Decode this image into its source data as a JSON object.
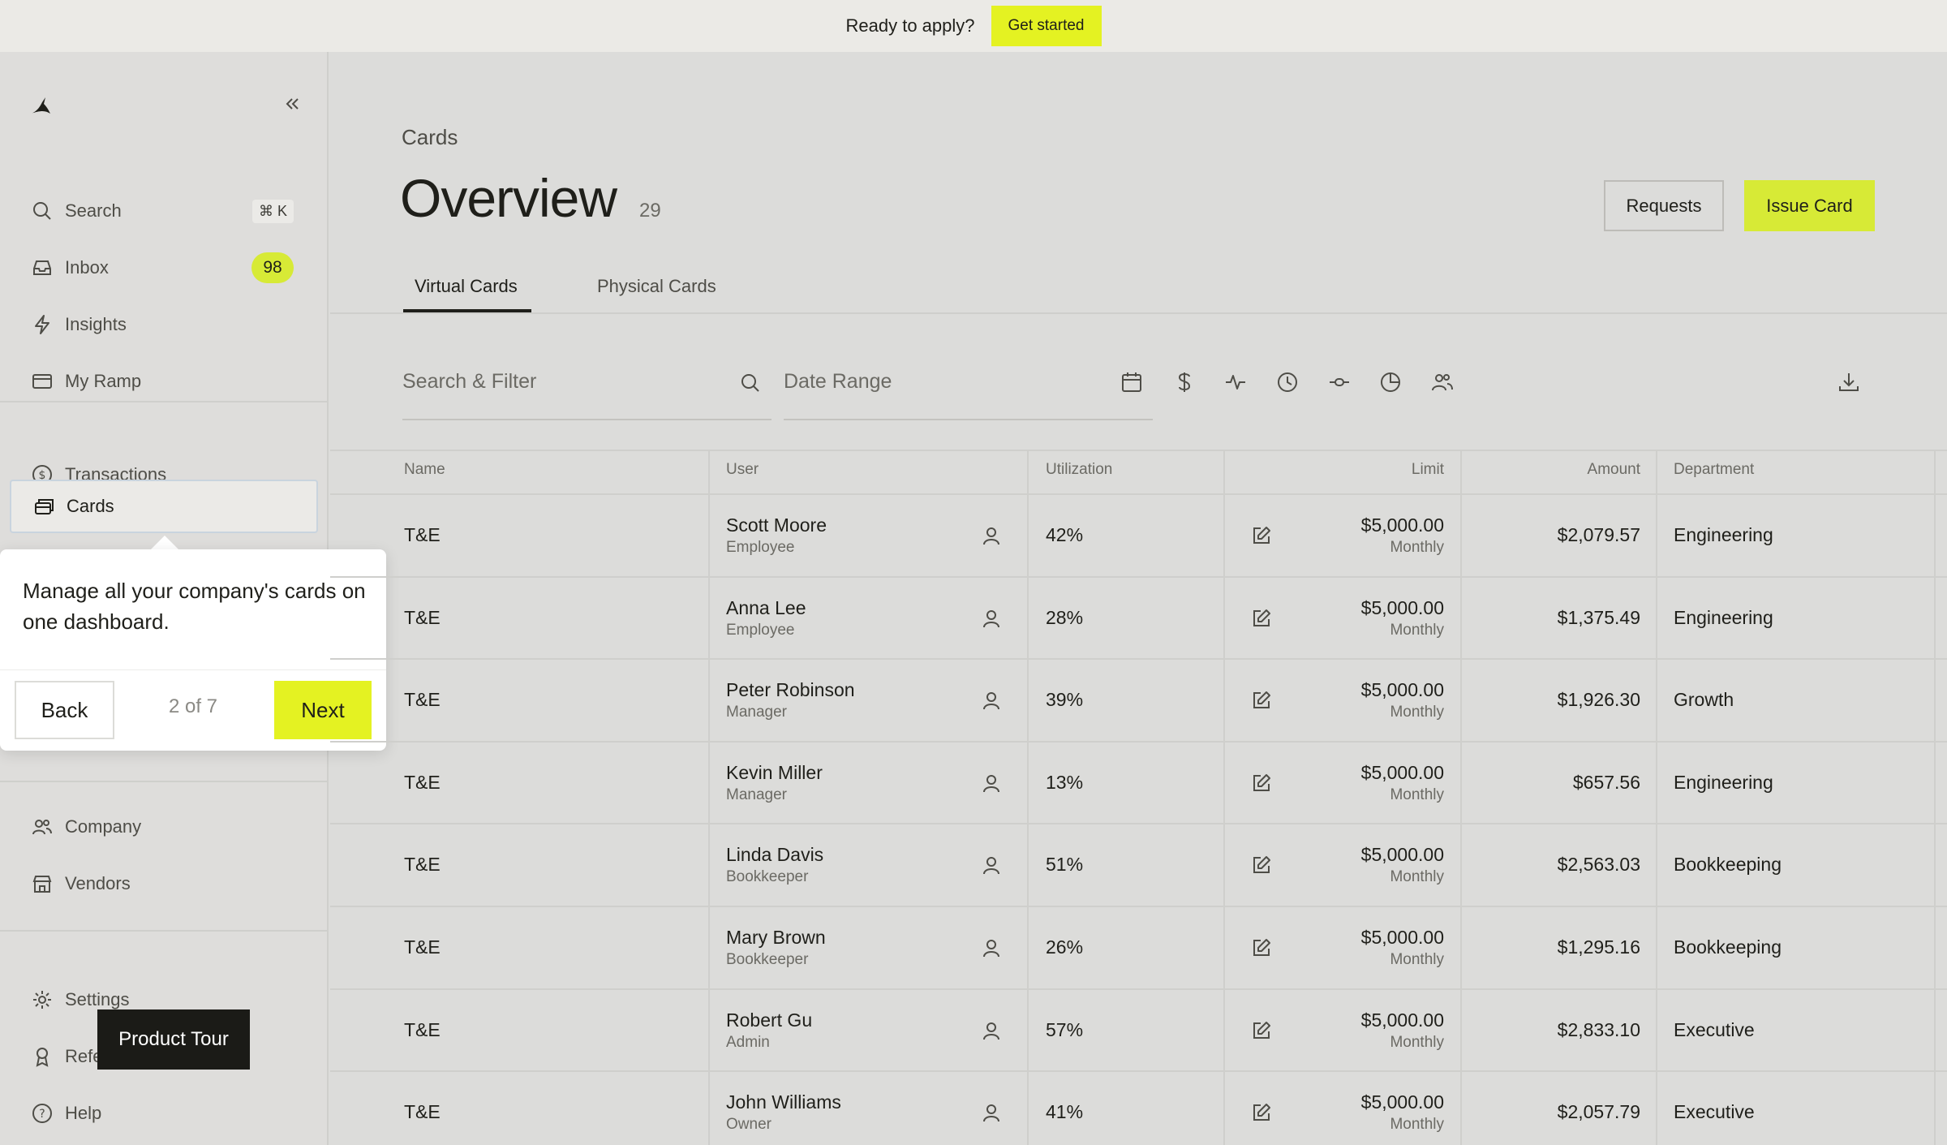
{
  "banner": {
    "text": "Ready to apply?",
    "cta": "Get started"
  },
  "sidebar": {
    "search": {
      "label": "Search",
      "shortcut": "⌘ K"
    },
    "inbox": {
      "label": "Inbox",
      "count": "98"
    },
    "insights": "Insights",
    "my_ramp": "My Ramp",
    "transactions": "Transactions",
    "cards": "Cards",
    "company": "Company",
    "vendors": "Vendors",
    "settings": "Settings",
    "referrals": "Refe",
    "help": "Help"
  },
  "tour": {
    "text": "Manage all your company's cards on one dashboard.",
    "back": "Back",
    "progress": "2 of 7",
    "next": "Next",
    "pill": "Product Tour"
  },
  "header": {
    "breadcrumb": "Cards",
    "title": "Overview",
    "count": "29",
    "requests": "Requests",
    "issue": "Issue Card"
  },
  "tabs": {
    "virtual": "Virtual Cards",
    "physical": "Physical Cards"
  },
  "filters": {
    "search_placeholder": "Search & Filter",
    "date_range": "Date Range"
  },
  "table": {
    "columns": {
      "name": "Name",
      "user": "User",
      "utilization": "Utilization",
      "limit": "Limit",
      "amount": "Amount",
      "department": "Department"
    },
    "rows": [
      {
        "name": "T&E",
        "user": "Scott Moore",
        "role": "Employee",
        "util": "42%",
        "limit": "$5,000.00",
        "period": "Monthly",
        "amount": "$2,079.57",
        "dept": "Engineering"
      },
      {
        "name": "T&E",
        "user": "Anna Lee",
        "role": "Employee",
        "util": "28%",
        "limit": "$5,000.00",
        "period": "Monthly",
        "amount": "$1,375.49",
        "dept": "Engineering"
      },
      {
        "name": "T&E",
        "user": "Peter Robinson",
        "role": "Manager",
        "util": "39%",
        "limit": "$5,000.00",
        "period": "Monthly",
        "amount": "$1,926.30",
        "dept": "Growth"
      },
      {
        "name": "T&E",
        "user": "Kevin Miller",
        "role": "Manager",
        "util": "13%",
        "limit": "$5,000.00",
        "period": "Monthly",
        "amount": "$657.56",
        "dept": "Engineering"
      },
      {
        "name": "T&E",
        "user": "Linda Davis",
        "role": "Bookkeeper",
        "util": "51%",
        "limit": "$5,000.00",
        "period": "Monthly",
        "amount": "$2,563.03",
        "dept": "Bookkeeping"
      },
      {
        "name": "T&E",
        "user": "Mary Brown",
        "role": "Bookkeeper",
        "util": "26%",
        "limit": "$5,000.00",
        "period": "Monthly",
        "amount": "$1,295.16",
        "dept": "Bookkeeping"
      },
      {
        "name": "T&E",
        "user": "Robert Gu",
        "role": "Admin",
        "util": "57%",
        "limit": "$5,000.00",
        "period": "Monthly",
        "amount": "$2,833.10",
        "dept": "Executive"
      },
      {
        "name": "T&E",
        "user": "John Williams",
        "role": "Owner",
        "util": "41%",
        "limit": "$5,000.00",
        "period": "Monthly",
        "amount": "$2,057.79",
        "dept": "Executive"
      }
    ]
  }
}
